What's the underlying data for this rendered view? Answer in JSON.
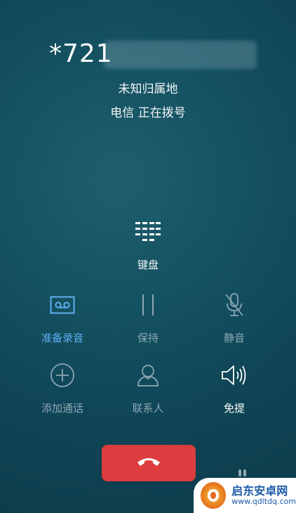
{
  "call": {
    "number": "*721",
    "location": "未知归属地",
    "status": "电信  正在拨号"
  },
  "keypad": {
    "icon": "dialpad-icon",
    "label": "键盘"
  },
  "controls": [
    {
      "id": "record",
      "icon": "voicemail-record-icon",
      "label": "准备录音",
      "state": "active"
    },
    {
      "id": "hold",
      "icon": "pause-icon",
      "label": "保持",
      "state": "disabled"
    },
    {
      "id": "mute",
      "icon": "microphone-muted-icon",
      "label": "静音",
      "state": "disabled"
    },
    {
      "id": "add-call",
      "icon": "plus-circle-icon",
      "label": "添加通话",
      "state": "disabled"
    },
    {
      "id": "contacts",
      "icon": "person-icon",
      "label": "联系人",
      "state": "disabled"
    },
    {
      "id": "speaker",
      "icon": "speaker-icon",
      "label": "免提",
      "state": "enabled"
    }
  ],
  "end_call": {
    "icon": "phone-hangup-icon",
    "color": "#db3d3f"
  },
  "colors": {
    "background": "#145161",
    "active": "#5fb0ef",
    "muted": "#8ba7b2"
  },
  "watermark": {
    "title": "启东安卓网",
    "url": "www.qdltdq.com"
  }
}
